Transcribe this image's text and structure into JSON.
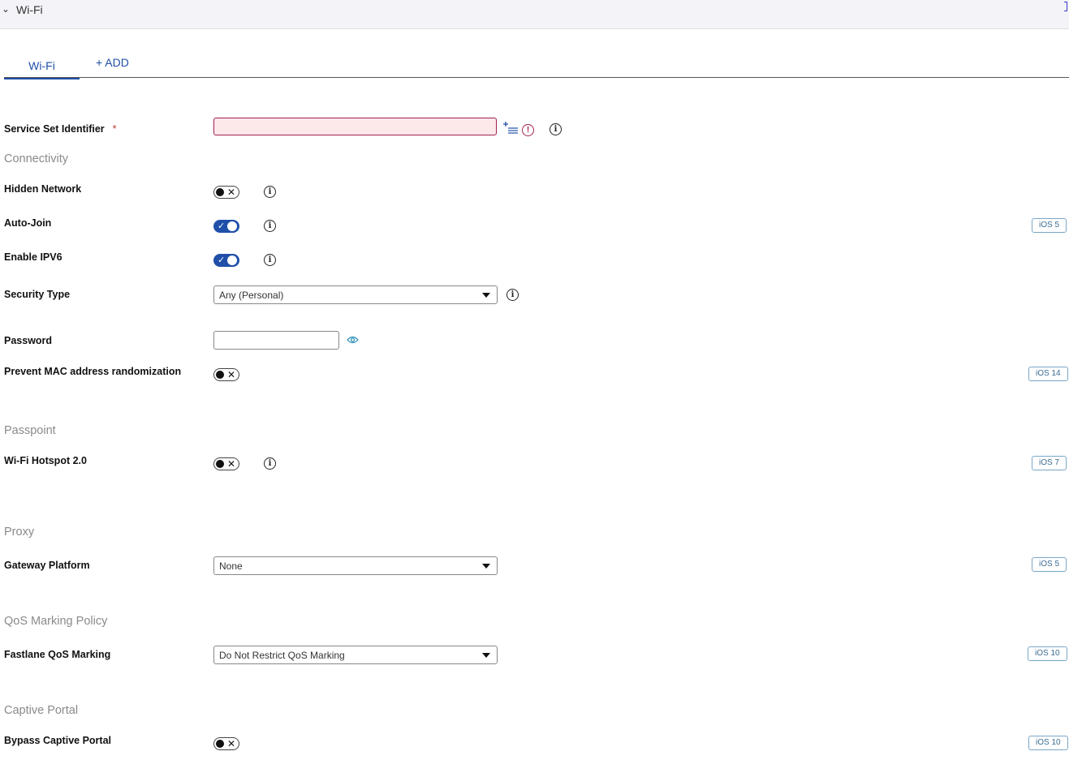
{
  "header": {
    "title": "Wi-Fi"
  },
  "tabs": {
    "active": "Wi-Fi",
    "add": "+ ADD"
  },
  "fields": {
    "ssid": {
      "label": "Service Set Identifier",
      "required": "*",
      "value": ""
    },
    "hidden_network": {
      "label": "Hidden Network"
    },
    "auto_join": {
      "label": "Auto-Join",
      "badge": "iOS 5"
    },
    "enable_ipv6": {
      "label": "Enable IPV6"
    },
    "security_type": {
      "label": "Security Type",
      "value": "Any (Personal)"
    },
    "password": {
      "label": "Password",
      "value": ""
    },
    "prevent_mac": {
      "label": "Prevent MAC address randomization",
      "badge": "iOS 14"
    },
    "hotspot": {
      "label": "Wi-Fi Hotspot 2.0",
      "badge": "iOS 7"
    },
    "gateway": {
      "label": "Gateway Platform",
      "value": "None",
      "badge": "iOS 5"
    },
    "fastlane": {
      "label": "Fastlane QoS Marking",
      "value": "Do Not Restrict QoS Marking",
      "badge": "iOS 10"
    },
    "bypass_portal": {
      "label": "Bypass Captive Portal",
      "badge": "iOS 10"
    }
  },
  "sections": {
    "connectivity": "Connectivity",
    "passpoint": "Passpoint",
    "proxy": "Proxy",
    "qos": "QoS Marking Policy",
    "captive": "Captive Portal"
  },
  "toggles": {
    "hidden_network": false,
    "auto_join": true,
    "enable_ipv6": true,
    "prevent_mac": false,
    "hotspot": false,
    "bypass_portal": false
  },
  "icons": {
    "chevron": "chevron-down-icon",
    "info": "info-icon",
    "error": "error-icon",
    "list_add": "list-add-icon",
    "eye": "eye-icon"
  },
  "colors": {
    "accent": "#1f4fa8",
    "error": "#a02050",
    "badge": "#3a6c92"
  }
}
